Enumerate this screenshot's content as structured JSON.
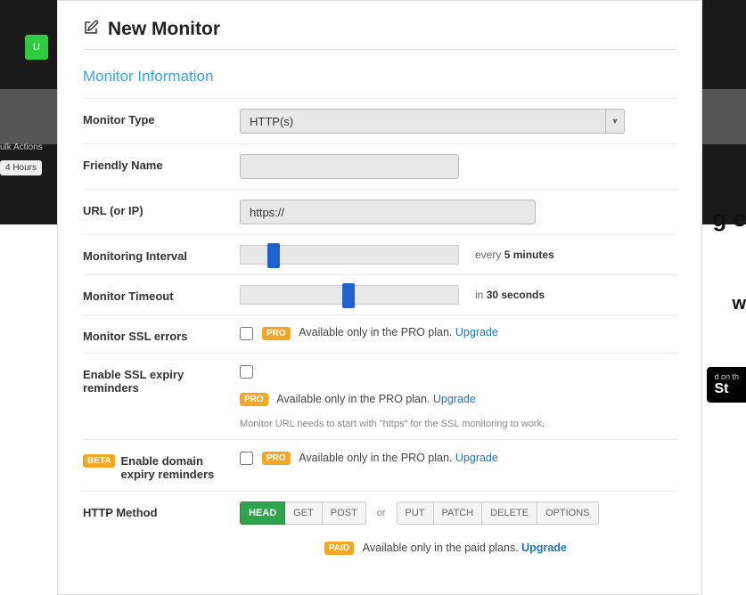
{
  "bg": {
    "upgrade_btn": "U",
    "bulk_actions": "ulk Actions",
    "hours_pill": "4 Hours",
    "right_frag1": "g e",
    "right_frag2": "w",
    "store_top": "d on th",
    "store_bottom": "St"
  },
  "modal": {
    "title": "New Monitor",
    "section": "Monitor Information",
    "labels": {
      "monitor_type": "Monitor Type",
      "friendly_name": "Friendly Name",
      "url": "URL (or IP)",
      "interval": "Monitoring Interval",
      "timeout": "Monitor Timeout",
      "ssl_errors": "Monitor SSL errors",
      "ssl_expiry": "Enable SSL expiry reminders",
      "domain_expiry": "Enable domain expiry reminders",
      "http_method": "HTTP Method"
    },
    "monitor_type_value": "HTTP(s)",
    "url_value": "https://",
    "interval_hint_prefix": "every ",
    "interval_hint_value": "5 minutes",
    "timeout_hint_prefix": "in ",
    "timeout_hint_value": "30 seconds",
    "badge_pro": "PRO",
    "badge_beta": "BETA",
    "badge_paid": "PAID",
    "pro_note": "Available only in the PRO plan.",
    "paid_note": "Available only in the paid plans.",
    "upgrade": "Upgrade",
    "ssl_hint": "Monitor URL needs to start with \"https\" for the SSL monitoring to work.",
    "http_methods": {
      "head": "HEAD",
      "get": "GET",
      "post": "POST",
      "or": "or",
      "put": "PUT",
      "patch": "PATCH",
      "delete": "DELETE",
      "options": "OPTIONS"
    }
  }
}
